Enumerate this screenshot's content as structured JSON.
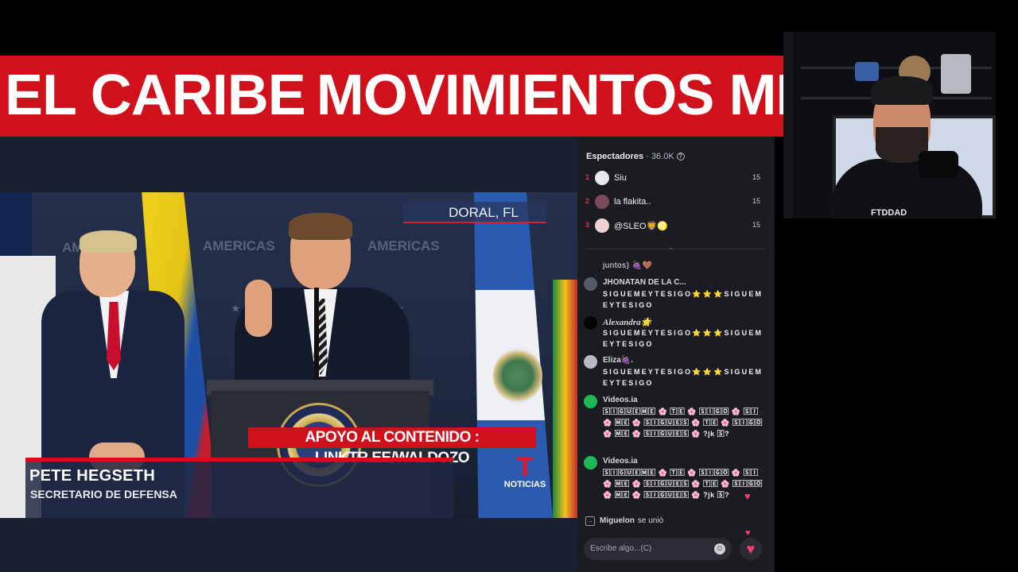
{
  "ticker": {
    "words": [
      "EL CARIBE",
      "MOVIMIENTOS MILITA"
    ]
  },
  "video": {
    "location": "DORAL, FL",
    "backdrop_word": "AMERICAS",
    "support_text": "APOYO AL CONTENIDO : LINKTR.EE/WALDOZO",
    "lower_third": {
      "name": "PETE HEGSETH",
      "title": "SECRETARIO DE DEFENSA"
    },
    "network_label": "NOTICIAS",
    "network_logo_letter": "T"
  },
  "chat": {
    "header_label": "Espectadores",
    "viewer_count": "· 36.0K",
    "top_viewers": [
      {
        "rank": "1",
        "name": "Siu",
        "score": "15"
      },
      {
        "rank": "2",
        "name": "la flakita..",
        "score": "15"
      },
      {
        "rank": "3",
        "name": "@SLEO🦁♌",
        "score": "15"
      }
    ],
    "messages": [
      {
        "user": "",
        "text": "juntos) 🍇🤎"
      },
      {
        "user": "JHONATAN DE LA C...",
        "text": "SIGUEMEYTESIGO⭐⭐⭐SIGUEMEYTESIGO"
      },
      {
        "user": "Alexandra🌟",
        "text": "SIGUEMEYTESIGO⭐⭐⭐SIGUEMEYTESIGO"
      },
      {
        "user": "Eliza🍇.",
        "text": "SIGUEMEYTESIGO⭐⭐⭐SIGUEMEYTESIGO"
      },
      {
        "user": "Videos.ia",
        "text": "🅂🄸🄶🅄🄴🄼🄴 🌸 🅃🄴 🌸 🅂🄸🄶🄾 🌸 🅂🄸 🌸 🄼🄴 🌸 🅂🄸🄶🅄🄴🅂 🌸 🅃🄴 🌸 🅂🄸🄶🄾 🌸 🄼🄴 🌸 🅂🄸🄶🅄🄴🅂 🌸 ?jk 🅂?"
      },
      {
        "user": "Videos.ia",
        "text": "🅂🄸🄶🅄🄴🄼🄴 🌸 🅃🄴 🌸 🅂🄸🄶🄾 🌸 🅂🄸 🌸 🄼🄴 🌸 🅂🄸🄶🅄🄴🅂 🌸 🅃🄴 🌸 🅂🄸🄶🄾 🌸 🄼🄴 🌸 🅂🄸🄶🅄🄴🅂 🌸 ?jk 🅂?"
      }
    ],
    "join": {
      "user": "Miguelon",
      "text": "se unió"
    },
    "input_placeholder": "Escribe algo...(C)"
  },
  "webcam": {
    "shirt_text": "FTDDAD"
  },
  "colors": {
    "ticker_red": "#d0101a",
    "chat_bg": "#1b1c22",
    "rank_red": "#e2314b",
    "heart": "#ff3b6b"
  },
  "icons": [
    "info-icon",
    "chevron-down-icon",
    "join-icon",
    "emoji-icon",
    "heart-icon"
  ]
}
